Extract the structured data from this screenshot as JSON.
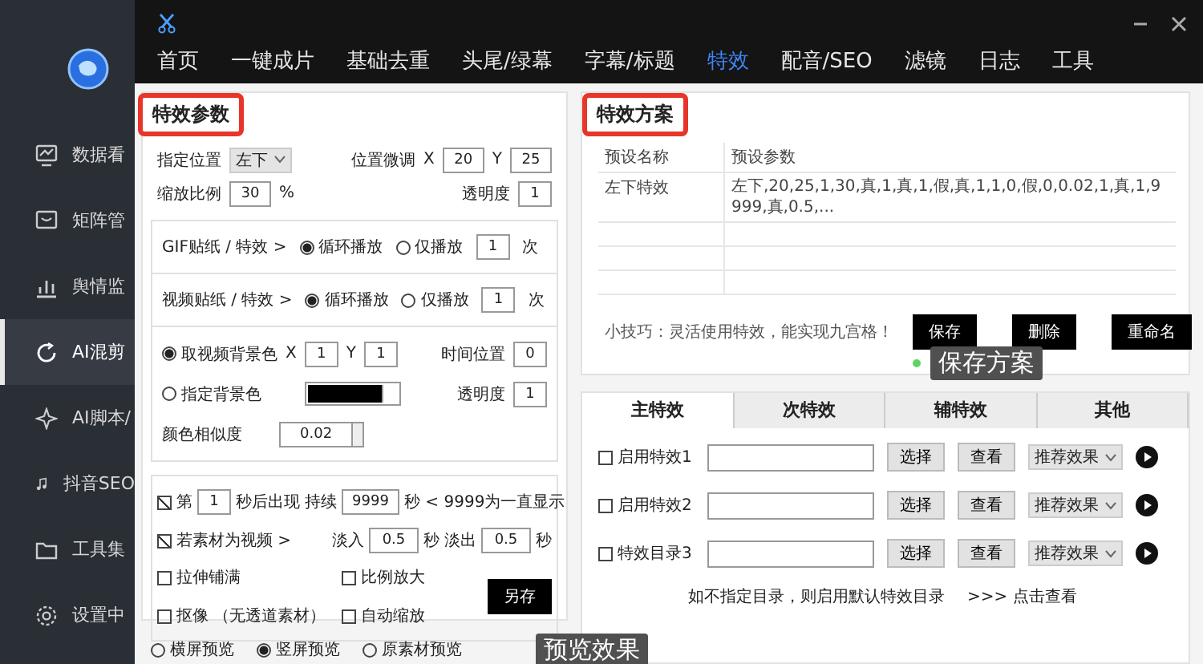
{
  "sidebar": {
    "items": [
      {
        "label": "数据看",
        "selected": false
      },
      {
        "label": "矩阵管",
        "selected": false
      },
      {
        "label": "舆情监",
        "selected": false
      },
      {
        "label": "AI混剪",
        "selected": true
      },
      {
        "label": "AI脚本/",
        "selected": false
      },
      {
        "label": "抖音SEO",
        "selected": false
      },
      {
        "label": "工具集",
        "selected": false
      },
      {
        "label": "设置中",
        "selected": false
      }
    ]
  },
  "topbar": {
    "tabs": [
      {
        "label": "首页",
        "selected": false
      },
      {
        "label": "一键成片",
        "selected": false
      },
      {
        "label": "基础去重",
        "selected": false
      },
      {
        "label": "头尾/绿幕",
        "selected": false
      },
      {
        "label": "字幕/标题",
        "selected": false
      },
      {
        "label": "特效",
        "selected": true
      },
      {
        "label": "配音/SEO",
        "selected": false
      },
      {
        "label": "滤镜",
        "selected": false
      },
      {
        "label": "日志",
        "selected": false
      },
      {
        "label": "工具",
        "selected": false
      }
    ]
  },
  "params": {
    "title": "特效参数",
    "rows": [
      {
        "items": [
          {
            "kind": "text",
            "text": "指定位置"
          },
          {
            "kind": "select",
            "value": "左下"
          },
          {
            "kind": "spacer"
          },
          {
            "kind": "text",
            "text": "位置微调"
          },
          {
            "kind": "text",
            "text": "X"
          },
          {
            "kind": "input",
            "value": "20"
          },
          {
            "kind": "text",
            "text": "Y"
          },
          {
            "kind": "input",
            "value": "25"
          }
        ]
      },
      {
        "items": [
          {
            "kind": "text",
            "text": "缩放比例"
          },
          {
            "kind": "input",
            "value": "30"
          },
          {
            "kind": "text",
            "text": "%"
          },
          {
            "kind": "spacer"
          },
          {
            "kind": "text",
            "text": "透明度"
          },
          {
            "kind": "input",
            "value": "1"
          }
        ]
      }
    ],
    "sticker_box": {
      "rows": [
        {
          "items": [
            {
              "kind": "text",
              "text": "GIF贴纸 / 特效 >"
            },
            {
              "kind": "radio",
              "text": "循环播放",
              "selected": true
            },
            {
              "kind": "radio",
              "text": "仅播放",
              "selected": false
            },
            {
              "kind": "input",
              "value": "1"
            },
            {
              "kind": "text",
              "text": "次"
            }
          ]
        },
        {
          "items": [
            {
              "kind": "text",
              "text": "视频贴纸 / 特效 >"
            },
            {
              "kind": "radio",
              "text": "循环播放",
              "selected": true
            },
            {
              "kind": "radio",
              "text": "仅播放",
              "selected": false
            },
            {
              "kind": "input",
              "value": "1"
            },
            {
              "kind": "text",
              "text": "次"
            }
          ]
        }
      ],
      "background_rows": [
        {
          "items": [
            {
              "kind": "radio",
              "text": "取视频背景色",
              "selected": true
            },
            {
              "kind": "text",
              "text": "X"
            },
            {
              "kind": "input",
              "value": "1"
            },
            {
              "kind": "text",
              "text": "Y"
            },
            {
              "kind": "input",
              "value": "1"
            },
            {
              "kind": "spacer"
            },
            {
              "kind": "text",
              "text": "时间位置"
            },
            {
              "kind": "input",
              "value": "0"
            }
          ]
        },
        {
          "items": [
            {
              "kind": "radio",
              "text": "指定背景色",
              "selected": false
            },
            {
              "kind": "color",
              "color": "#000000"
            },
            {
              "kind": "spacer"
            },
            {
              "kind": "text",
              "text": "透明度"
            },
            {
              "kind": "input",
              "value": "1"
            }
          ]
        },
        {
          "items": [
            {
              "kind": "text",
              "text": "颜色相似度"
            },
            {
              "kind": "spinner",
              "value": "0.02"
            }
          ]
        }
      ]
    },
    "timing_box": {
      "rows": [
        {
          "items": [
            {
              "kind": "checkbox",
              "text": "第",
              "checked": true
            },
            {
              "kind": "input",
              "value": "1"
            },
            {
              "kind": "text",
              "text": "秒后出现"
            },
            {
              "kind": "text",
              "text": "持续"
            },
            {
              "kind": "input",
              "value": "9999"
            },
            {
              "kind": "text",
              "text": "秒 < 9999为一直显示"
            }
          ]
        },
        {
          "items": [
            {
              "kind": "checkbox",
              "text": "若素材为视频 >",
              "checked": true
            },
            {
              "kind": "spacer"
            },
            {
              "kind": "text",
              "text": "淡入"
            },
            {
              "kind": "input",
              "value": "0.5"
            },
            {
              "kind": "text",
              "text": "秒"
            },
            {
              "kind": "text",
              "text": "淡出"
            },
            {
              "kind": "input",
              "value": "0.5"
            },
            {
              "kind": "text",
              "text": "秒"
            }
          ]
        }
      ],
      "options": [
        {
          "text": "拉伸铺满",
          "checked": false
        },
        {
          "text": "比例放大",
          "checked": false
        },
        {
          "text": "抠像 （无透道素材）",
          "checked": false
        },
        {
          "text": "自动缩放",
          "checked": false
        }
      ],
      "save_button": "另存"
    },
    "preview": {
      "options": [
        {
          "text": "横屏预览",
          "selected": false
        },
        {
          "text": "竖屏预览",
          "selected": true
        },
        {
          "text": "原素材预览",
          "selected": false
        }
      ],
      "tooltip": "预览效果"
    }
  },
  "presets": {
    "title": "特效方案",
    "columns": [
      "预设名称",
      "预设参数"
    ],
    "rows": [
      {
        "name": "左下特效",
        "params": "左下,20,25,1,30,真,1,真,1,假,真,1,1,0,假,0,0.02,1,真,1,9999,真,0.5,..."
      }
    ],
    "tip": "小技巧：灵活使用特效，能实现九宫格！",
    "buttons": [
      "保存",
      "删除",
      "重命名"
    ],
    "tooltip": "保存方案"
  },
  "effects": {
    "tabs": [
      {
        "label": "主特效",
        "selected": true
      },
      {
        "label": "次特效",
        "selected": false
      },
      {
        "label": "辅特效",
        "selected": false
      },
      {
        "label": "其他",
        "selected": false
      }
    ],
    "rows": [
      {
        "label": "启用特效1",
        "checked": false,
        "choose": "选择",
        "view": "查看",
        "preset": "推荐效果"
      },
      {
        "label": "启用特效2",
        "checked": false,
        "choose": "选择",
        "view": "查看",
        "preset": "推荐效果"
      },
      {
        "label": "特效目录3",
        "checked": false,
        "choose": "选择",
        "view": "查看",
        "preset": "推荐效果"
      }
    ],
    "note": "如不指定目录，则启用默认特效目录",
    "link": ">>> 点击查看"
  }
}
